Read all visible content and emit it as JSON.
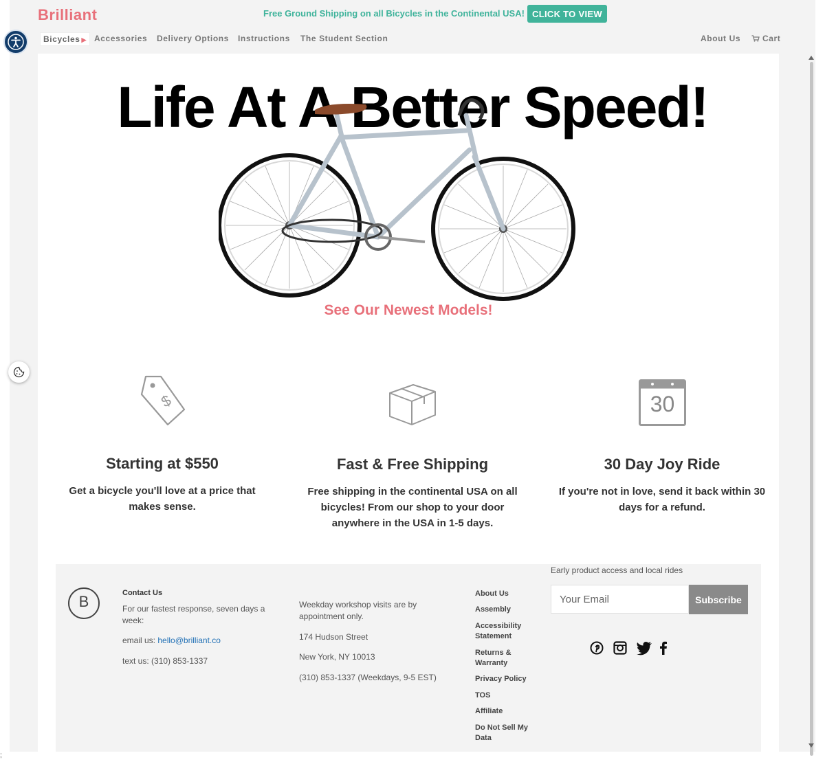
{
  "header": {
    "logo": "Brilliant",
    "promo_text": "Free Ground Shipping on all Bicycles in the Continental USA!",
    "promo_button": "CLICK TO VIEW",
    "accessibility_icon": "accessibility-person-icon"
  },
  "nav": {
    "items": [
      "Bicycles",
      "Accessories",
      "Delivery Options",
      "Instructions",
      "The Student Section"
    ],
    "right": {
      "about": "About Us",
      "cart": "Cart"
    },
    "cart_icon": "shopping-cart-icon"
  },
  "hero": {
    "title": "Life At A Better Speed!",
    "link": "See Our Newest Models!"
  },
  "features": [
    {
      "icon": "price-tag-dollar-icon",
      "title": "Starting at $550",
      "text": "Get a bicycle you'll love at a price that makes sense."
    },
    {
      "icon": "box-package-icon",
      "title": "Fast & Free Shipping",
      "text": "Free shipping in the continental USA on all bicycles! From our shop to your door anywhere in the USA in 1-5 days."
    },
    {
      "icon": "calendar-icon",
      "calendar_number": "30",
      "title": "30 Day Joy Ride",
      "text": "If you're not in love, send it back within 30 days for a refund."
    }
  ],
  "footer": {
    "logo_letter": "B",
    "contact": {
      "heading": "Contact Us",
      "intro": "For our fastest response, seven days a week:",
      "email_label": "email us:",
      "email": "hello@brilliant.co",
      "text_label": "text us: (310) 853-1337"
    },
    "workshop": {
      "note": "Weekday workshop visits are by appointment only.",
      "street": "174 Hudson Street",
      "city": "New York, NY 10013",
      "phone": "(310) 853-1337 (Weekdays, 9-5 EST)"
    },
    "links": [
      "About Us",
      "Assembly",
      "Accessibility Statement",
      "Returns & Warranty",
      "Privacy Policy",
      "TOS",
      "Affiliate",
      "Do Not Sell My Data"
    ],
    "subscribe": {
      "label": "Early product access and local rides",
      "placeholder": "Your Email",
      "button": "Subscribe"
    },
    "social_icons": [
      "pinterest-icon",
      "instagram-icon",
      "twitter-icon",
      "facebook-icon"
    ]
  },
  "misc": {
    "stray_char": ";"
  },
  "colors": {
    "brand": "#e8707a",
    "promo_green": "#3fb39b",
    "link_blue": "#2472b6"
  }
}
